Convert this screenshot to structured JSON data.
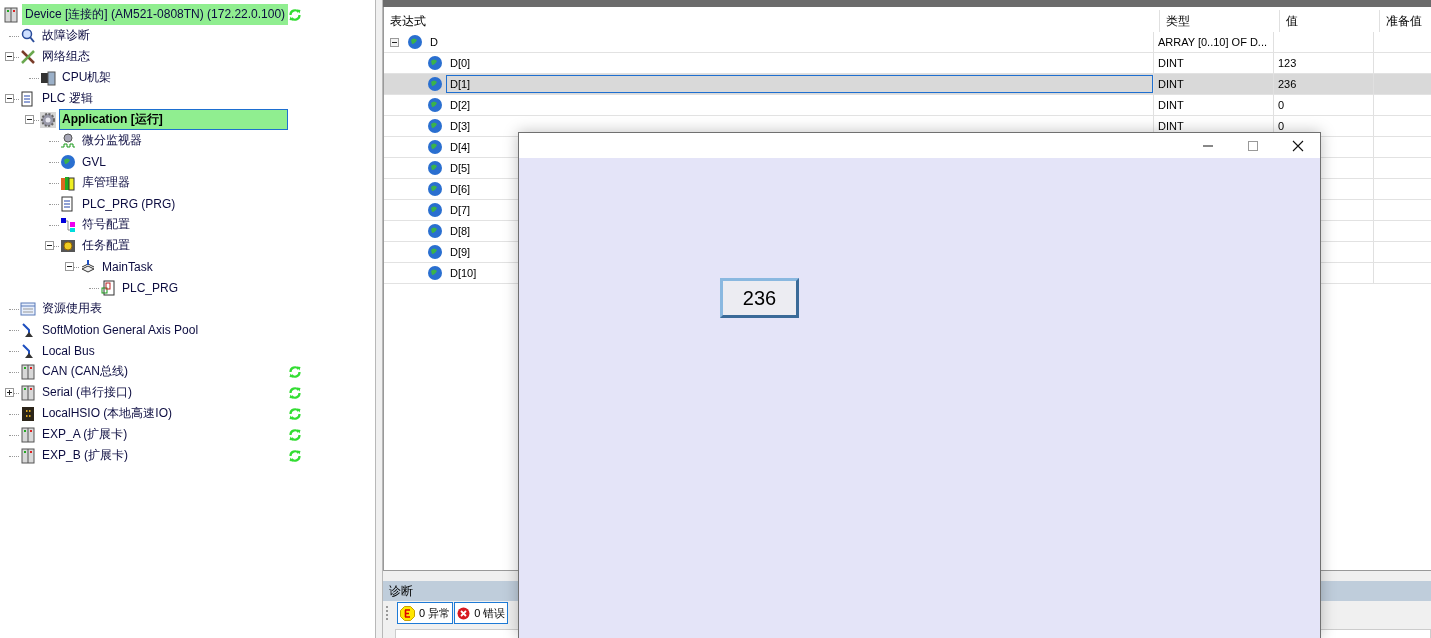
{
  "tree": {
    "items": [
      {
        "kind": "device",
        "label": "Device [连接的] (AM521-0808TN) (172.22.0.100)",
        "highlighted": true,
        "selected": false,
        "synced": true,
        "children": [
          {
            "kind": "diagnosis",
            "label": "故障诊断",
            "highlighted": false,
            "selected": false,
            "synced": false
          },
          {
            "kind": "network",
            "label": "网络组态",
            "highlighted": false,
            "selected": false,
            "synced": false,
            "expanded": true,
            "children": [
              {
                "kind": "cpu",
                "label": "CPU机架",
                "highlighted": false,
                "selected": false,
                "synced": false
              }
            ]
          },
          {
            "kind": "logic",
            "label": "PLC 逻辑",
            "highlighted": false,
            "selected": false,
            "synced": false,
            "expanded": true,
            "children": [
              {
                "kind": "app",
                "label": "Application [运行]",
                "highlighted": true,
                "selected": true,
                "synced": false,
                "expanded": true,
                "children": [
                  {
                    "kind": "monitor",
                    "label": "微分监视器",
                    "highlighted": false,
                    "selected": false,
                    "synced": false
                  },
                  {
                    "kind": "gvl",
                    "label": "GVL",
                    "highlighted": false,
                    "selected": false,
                    "synced": false
                  },
                  {
                    "kind": "library",
                    "label": "库管理器",
                    "highlighted": false,
                    "selected": false,
                    "synced": false
                  },
                  {
                    "kind": "program",
                    "label": "PLC_PRG (PRG)",
                    "highlighted": false,
                    "selected": false,
                    "synced": false
                  },
                  {
                    "kind": "symbol",
                    "label": "符号配置",
                    "highlighted": false,
                    "selected": false,
                    "synced": false
                  },
                  {
                    "kind": "task",
                    "label": "任务配置",
                    "highlighted": false,
                    "selected": false,
                    "synced": false,
                    "expanded": true,
                    "children": [
                      {
                        "kind": "maintask",
                        "label": "MainTask",
                        "highlighted": false,
                        "selected": false,
                        "synced": false,
                        "expanded": true,
                        "children": [
                          {
                            "kind": "pou",
                            "label": "PLC_PRG",
                            "highlighted": false,
                            "selected": false,
                            "synced": false
                          }
                        ]
                      }
                    ]
                  }
                ]
              }
            ]
          },
          {
            "kind": "resource",
            "label": "资源使用表",
            "highlighted": false,
            "selected": false,
            "synced": false
          },
          {
            "kind": "axis",
            "label": "SoftMotion General Axis Pool",
            "highlighted": false,
            "selected": false,
            "synced": false
          },
          {
            "kind": "axis",
            "label": "Local Bus",
            "highlighted": false,
            "selected": false,
            "synced": false
          },
          {
            "kind": "device",
            "label": "CAN (CAN总线)",
            "highlighted": false,
            "selected": false,
            "synced": true
          },
          {
            "kind": "device",
            "label": "Serial (串行接口)",
            "highlighted": false,
            "selected": false,
            "synced": true,
            "expanded": false
          },
          {
            "kind": "hsio",
            "label": "LocalHSIO (本地高速IO)",
            "highlighted": false,
            "selected": false,
            "synced": true
          },
          {
            "kind": "device",
            "label": "EXP_A (扩展卡)",
            "highlighted": false,
            "selected": false,
            "synced": true
          },
          {
            "kind": "device",
            "label": "EXP_B (扩展卡)",
            "highlighted": false,
            "selected": false,
            "synced": true
          }
        ]
      }
    ]
  },
  "watch": {
    "columns": [
      "表达式",
      "类型",
      "值",
      "准备值"
    ],
    "rows": [
      {
        "expression": "D",
        "type": "ARRAY [0..10] OF D...",
        "selected": false,
        "expanded": true,
        "children": [
          {
            "expression": "D[0]",
            "type": "DINT",
            "value": "123",
            "selected": false
          },
          {
            "expression": "D[1]",
            "type": "DINT",
            "value": "236",
            "selected": true
          },
          {
            "expression": "D[2]",
            "type": "DINT",
            "value": "0",
            "selected": false
          },
          {
            "expression": "D[3]",
            "type": "DINT",
            "value": "0",
            "selected": false
          },
          {
            "expression": "D[4]",
            "selected": false
          },
          {
            "expression": "D[5]",
            "selected": false
          },
          {
            "expression": "D[6]",
            "selected": false
          },
          {
            "expression": "D[7]",
            "selected": false
          },
          {
            "expression": "D[8]",
            "selected": false
          },
          {
            "expression": "D[9]",
            "selected": false
          },
          {
            "expression": "D[10]",
            "selected": false
          }
        ]
      }
    ]
  },
  "diagnostics": {
    "title": "诊断",
    "filters": [
      {
        "kind": "exception",
        "label": "0 异常"
      },
      {
        "kind": "error",
        "label": "0 错误"
      }
    ]
  },
  "popup": {
    "display": "236"
  }
}
